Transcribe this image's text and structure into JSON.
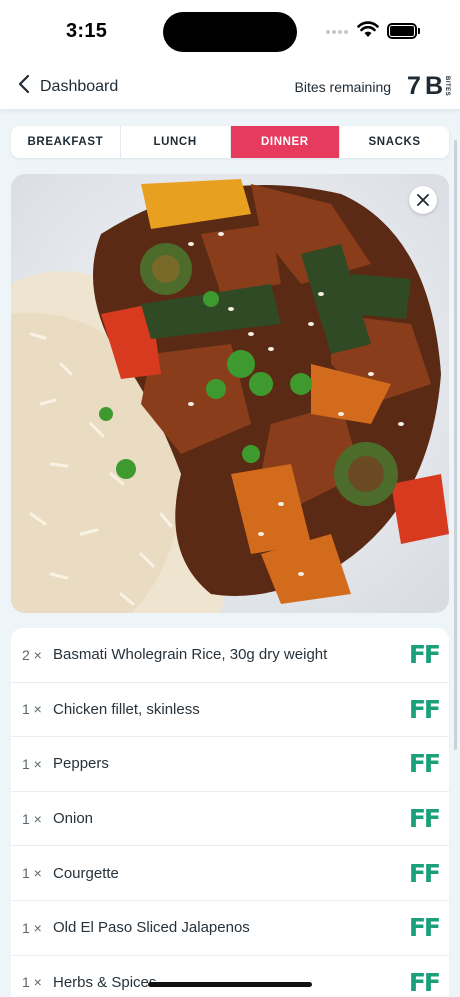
{
  "status_bar": {
    "time": "3:15",
    "icons": [
      "cellular-signal-icon",
      "wifi-icon",
      "battery-icon"
    ]
  },
  "header": {
    "back_label": "Dashboard",
    "back_icon": "chevron-left-icon",
    "bites_label": "Bites remaining",
    "bites_count": "7",
    "bites_logo_letter": "B",
    "bites_logo_word": "BITES"
  },
  "tabs": [
    {
      "label": "BREAKFAST",
      "active": false
    },
    {
      "label": "LUNCH",
      "active": false
    },
    {
      "label": "DINNER",
      "active": true
    },
    {
      "label": "SNACKS",
      "active": false
    }
  ],
  "photo": {
    "subject": "chicken, peppers and courgette stir fry with basmati rice and sesame seeds",
    "close_icon": "close-icon"
  },
  "ingredients": [
    {
      "qty": "2 ×",
      "name": "Basmati Wholegrain Rice, 30g dry weight",
      "badge": "FF"
    },
    {
      "qty": "1 ×",
      "name": "Chicken fillet, skinless",
      "badge": "FF"
    },
    {
      "qty": "1 ×",
      "name": "Peppers",
      "badge": "FF"
    },
    {
      "qty": "1 ×",
      "name": "Onion",
      "badge": "FF"
    },
    {
      "qty": "1 ×",
      "name": "Courgette",
      "badge": "FF"
    },
    {
      "qty": "1 ×",
      "name": "Old El Paso Sliced Jalapenos",
      "badge": "FF"
    },
    {
      "qty": "1 ×",
      "name": "Herbs & Spices",
      "badge": "FF"
    }
  ],
  "colors": {
    "accent": "#e63b5c",
    "badge": "#1aa07a",
    "background": "#eef5f8"
  }
}
